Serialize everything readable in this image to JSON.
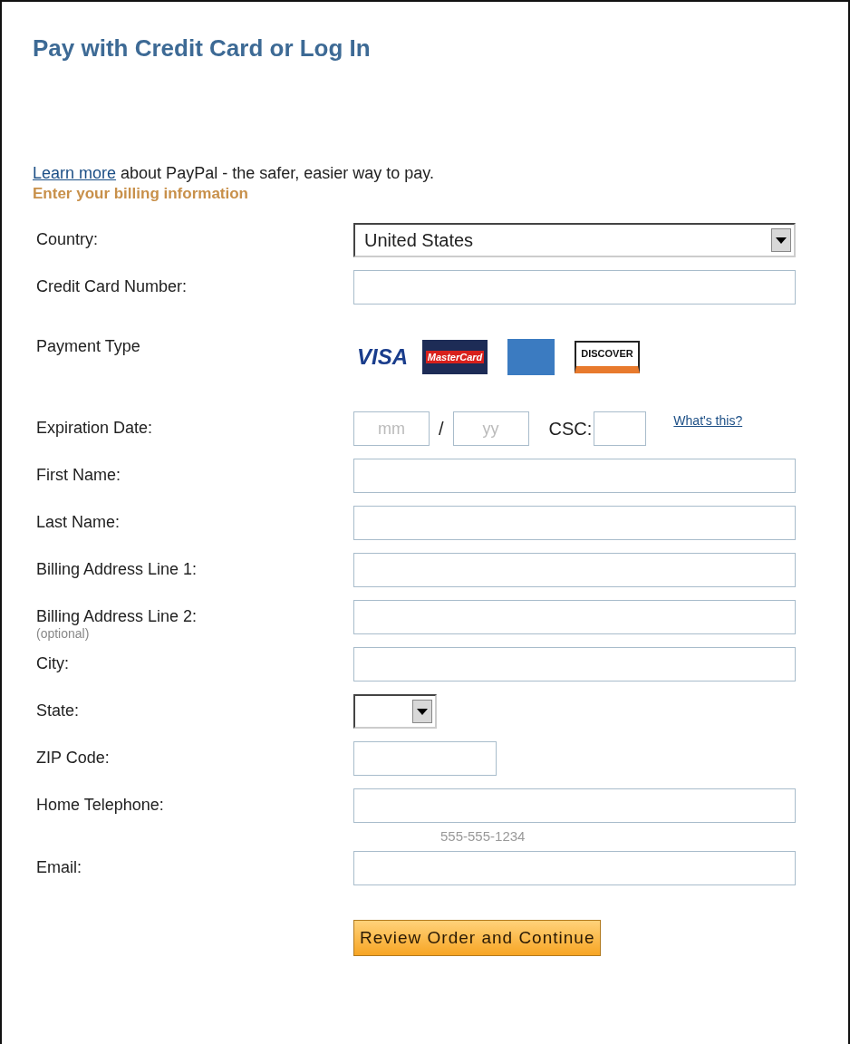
{
  "title": "Pay with Credit Card or Log In",
  "intro": {
    "link": "Learn more",
    "text": "about PayPal - the safer, easier way to pay."
  },
  "section_heading": "Enter your billing information",
  "fields": [
    {
      "kind": "select",
      "label": "Country:",
      "value": "United States"
    },
    {
      "kind": "text",
      "label": "Credit Card Number:"
    },
    {
      "kind": "cards",
      "label": "Payment Type",
      "cards": [
        {
          "kind": "visa",
          "label": "VISA"
        },
        {
          "kind": "mastercard",
          "label": "MasterCard"
        },
        {
          "kind": "amex"
        },
        {
          "kind": "discover",
          "label": "DISCOVER"
        }
      ]
    },
    {
      "kind": "expiry",
      "label": "Expiration Date:",
      "month_placeholder": "mm",
      "separator": "/",
      "year_placeholder": "yy",
      "csc_label": "CSC:",
      "help_link": "What's this?"
    },
    {
      "kind": "text",
      "label": "First Name:"
    },
    {
      "kind": "text",
      "label": "Last Name:"
    },
    {
      "kind": "text",
      "label": "Billing Address Line 1:"
    },
    {
      "kind": "text",
      "label": "Billing Address Line 2:",
      "note": "(optional)"
    },
    {
      "kind": "text",
      "label": "City:"
    },
    {
      "kind": "small-select",
      "label": "State:"
    },
    {
      "kind": "short",
      "label": "ZIP Code:"
    },
    {
      "kind": "text",
      "label": "Home Telephone:",
      "hint": "555-555-1234"
    },
    {
      "kind": "text",
      "label": "Email:"
    }
  ],
  "submit": "Review Order and Continue"
}
